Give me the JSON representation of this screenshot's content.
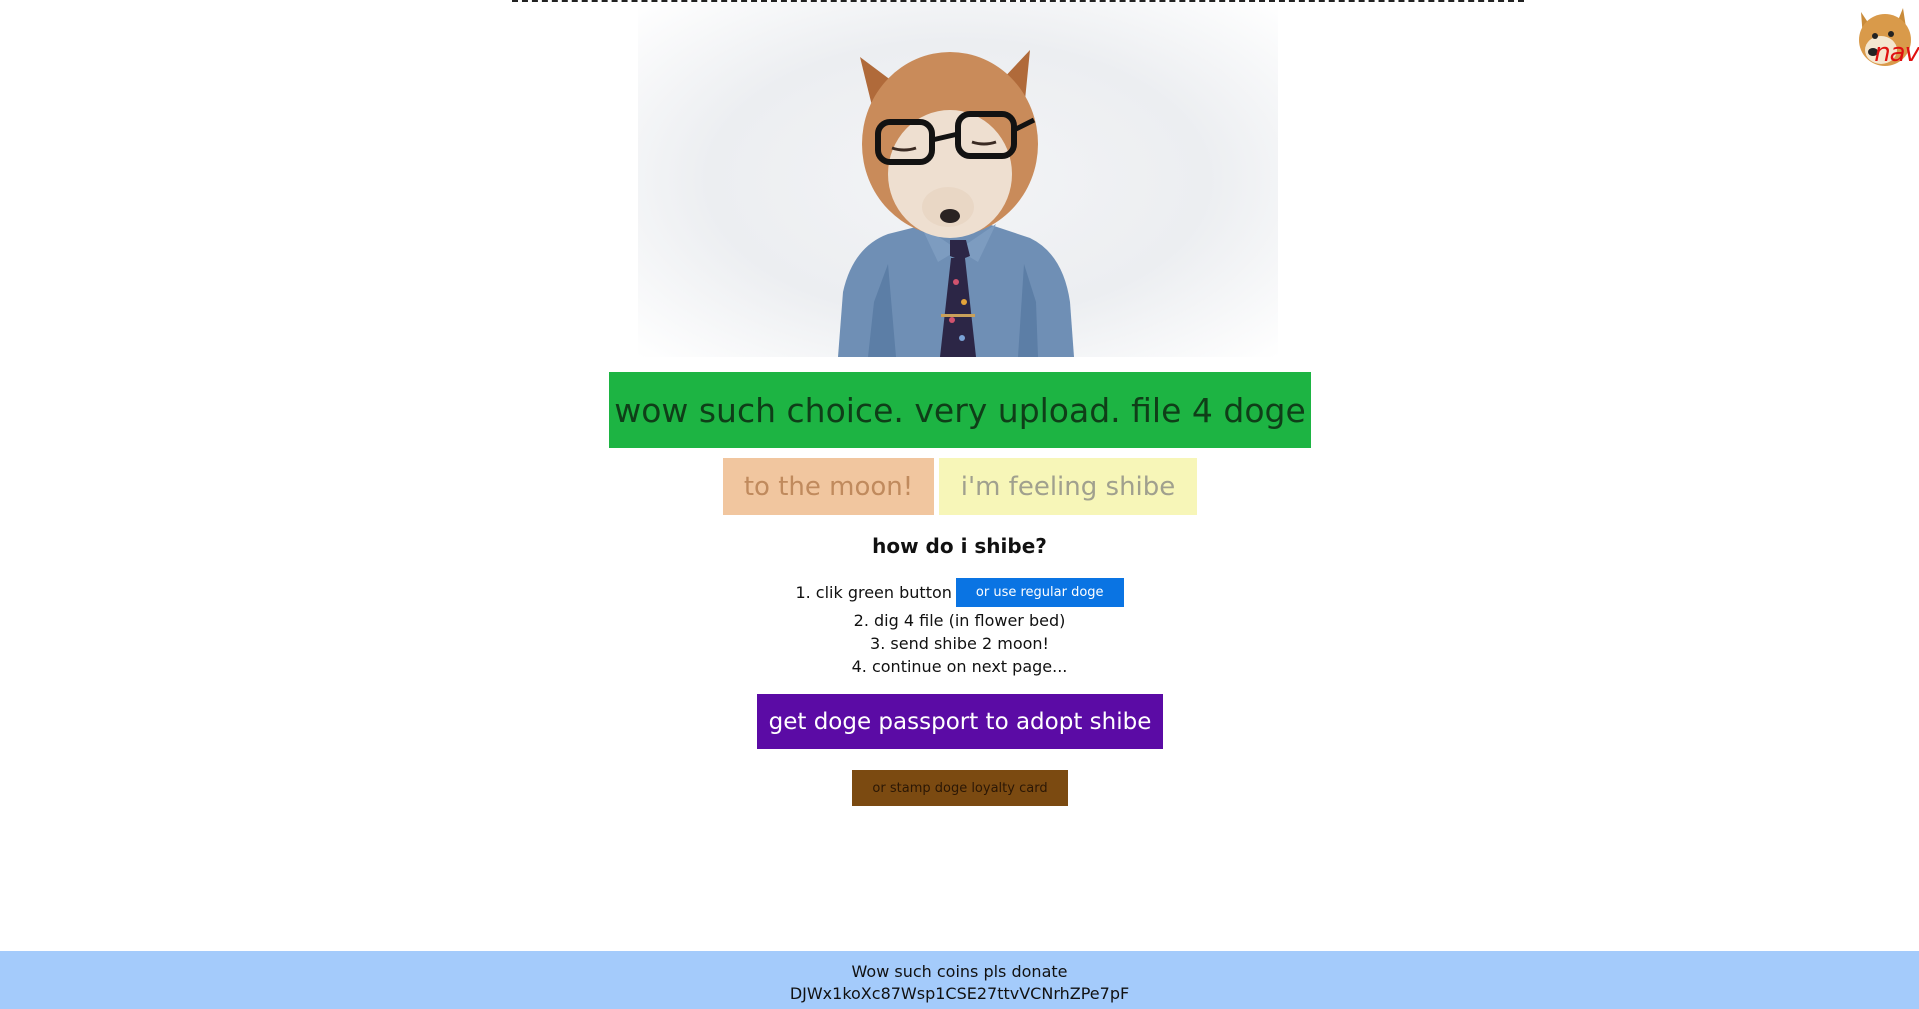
{
  "nav": {
    "label": "nav",
    "icon": "doge-face-icon"
  },
  "hero": {
    "icon": "shibe-in-shirt-and-glasses-photo"
  },
  "actions": {
    "upload_label": "wow such choice. very upload. file 4 doge",
    "moon_label": "to the moon!",
    "feeling_label": "i'm feeling shibe",
    "upload_color": "#1db443",
    "moon_color": "#f1c69f",
    "feeling_color": "#f7f6b8"
  },
  "howto": {
    "title": "how do i shibe?",
    "step1_text": "1. clik green button",
    "regular_doge_label": "or use regular doge",
    "step2_text": "2. dig 4 file (in flower bed)",
    "step3_text": "3. send shibe 2 moon!",
    "step4_text": "4. continue on next page..."
  },
  "passport": {
    "label": "get doge passport to adopt shibe",
    "color": "#5b0ba5"
  },
  "loyalty": {
    "label": "or stamp doge loyalty card",
    "color": "#7b4a11"
  },
  "footer": {
    "line1": "Wow such coins pls donate",
    "line2": "DJWx1koXc87Wsp1CSE27ttvVCNrhZPe7pF",
    "color": "#a4cbfb"
  }
}
